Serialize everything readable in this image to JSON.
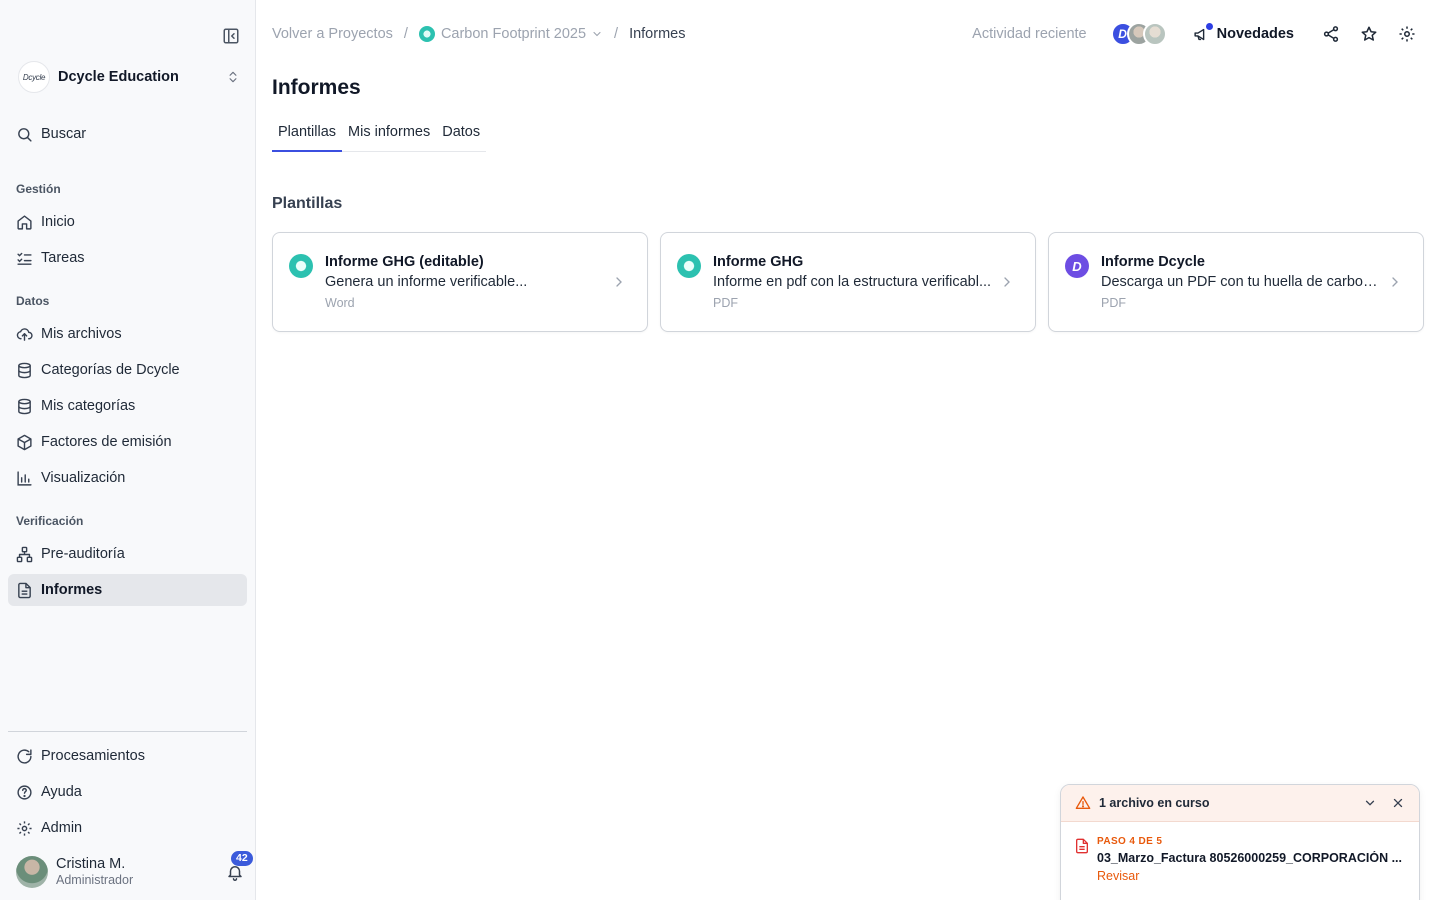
{
  "sidebar": {
    "org": {
      "logo_text": "Dcycle",
      "name": "Dcycle Education"
    },
    "search_label": "Buscar",
    "sections": {
      "gestion": "Gestión",
      "datos": "Datos",
      "verificacion": "Verificación"
    },
    "items": {
      "inicio": "Inicio",
      "tareas": "Tareas",
      "mis_archivos": "Mis archivos",
      "categorias_dcycle": "Categorías de Dcycle",
      "mis_categorias": "Mis categorías",
      "factores": "Factores de emisión",
      "visualizacion": "Visualización",
      "preauditoria": "Pre-auditoría",
      "informes": "Informes",
      "procesamientos": "Procesamientos",
      "ayuda": "Ayuda",
      "admin": "Admin"
    },
    "user": {
      "name": "Cristina M.",
      "role": "Administrador",
      "notifications": "42"
    }
  },
  "header": {
    "breadcrumb": {
      "back": "Volver a Proyectos",
      "project": "Carbon Footprint 2025",
      "current": "Informes",
      "separator": "/"
    },
    "recent_activity": "Actividad reciente",
    "avatar_logo_text": "D",
    "news_label": "Novedades"
  },
  "main": {
    "title": "Informes",
    "tabs": [
      "Plantillas",
      "Mis informes",
      "Datos"
    ],
    "active_tab": "Plantillas",
    "section_title": "Plantillas",
    "cards": [
      {
        "title": "Informe GHG (editable)",
        "description": "Genera un informe verificable...",
        "type": "Word",
        "icon": "teal-circle-icon"
      },
      {
        "title": "Informe GHG",
        "description": "Informe en pdf con la estructura verificabl...",
        "type": "PDF",
        "icon": "teal-circle-icon"
      },
      {
        "title": "Informe Dcycle",
        "description": "Descarga un PDF con tu huella de carbon...",
        "type": "PDF",
        "icon": "dcycle-logo-icon",
        "icon_text": "D"
      }
    ]
  },
  "upload_panel": {
    "title": "1 archivo en curso",
    "step": "PASO 4 DE 5",
    "filename": "03_Marzo_Factura 80526000259_CORPORACIÓN ...",
    "action": "Revisar"
  },
  "colors": {
    "accent": "#3b4fe0",
    "teal": "#2cc1b0",
    "purple": "#6d4de3",
    "warning": "#e8590c"
  }
}
